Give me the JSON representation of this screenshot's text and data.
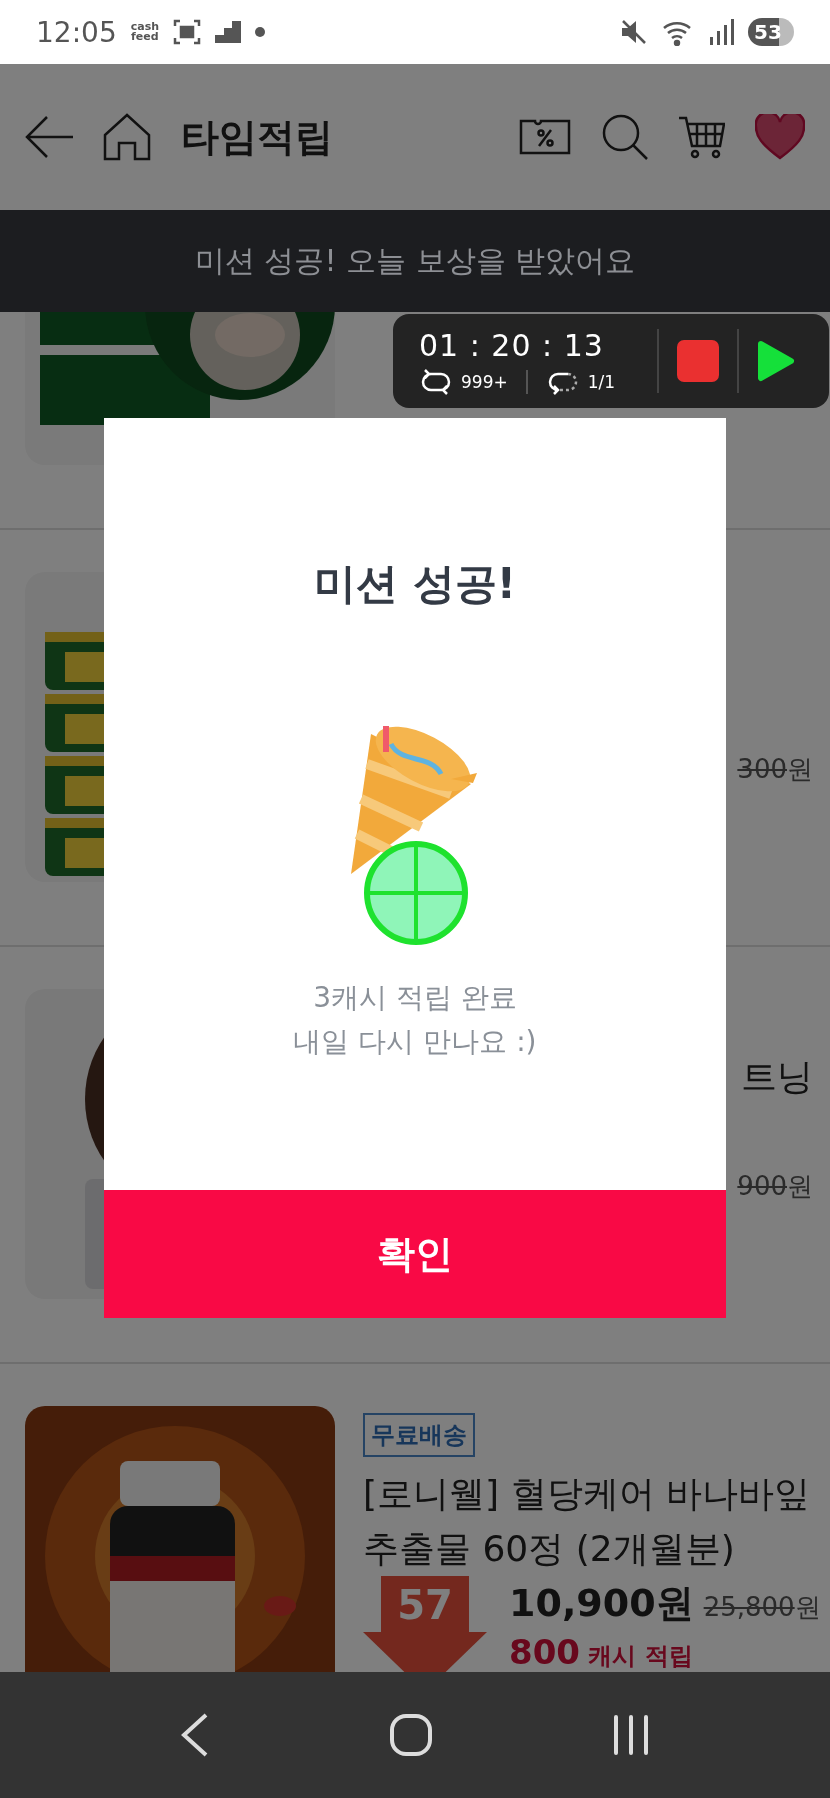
{
  "status_bar": {
    "time": "12:05",
    "app_badge": [
      "cash",
      "feed"
    ],
    "battery": "53"
  },
  "header": {
    "title": "타임적립"
  },
  "banner": {
    "text": "미션 성공! 오늘 보상을 받았어요"
  },
  "products": [
    {
      "kind": "covered"
    },
    {
      "kind": "covered",
      "old_price": "300",
      "currency": "원"
    },
    {
      "kind": "covered",
      "title": [
        "트닝"
      ],
      "old_price": "900",
      "currency": "원"
    },
    {
      "kind": "full",
      "badge": "무료배송",
      "title": [
        "[로니웰] 혈당케어 바나바잎",
        "추출물 60정 (2개월분)"
      ],
      "discount": "57",
      "price": "10,900원",
      "old_price": "25,800",
      "currency": "원",
      "cash_amount": "800",
      "cash_label": "캐시 적립"
    }
  ],
  "timer": {
    "time": "01 : 20 : 13",
    "repeat_count": "999+",
    "loop_count": "1/1"
  },
  "modal": {
    "title": "미션 성공!",
    "lines": [
      "3캐시 적립 완료",
      "내일 다시 만나요 :)"
    ],
    "confirm": "확인"
  }
}
